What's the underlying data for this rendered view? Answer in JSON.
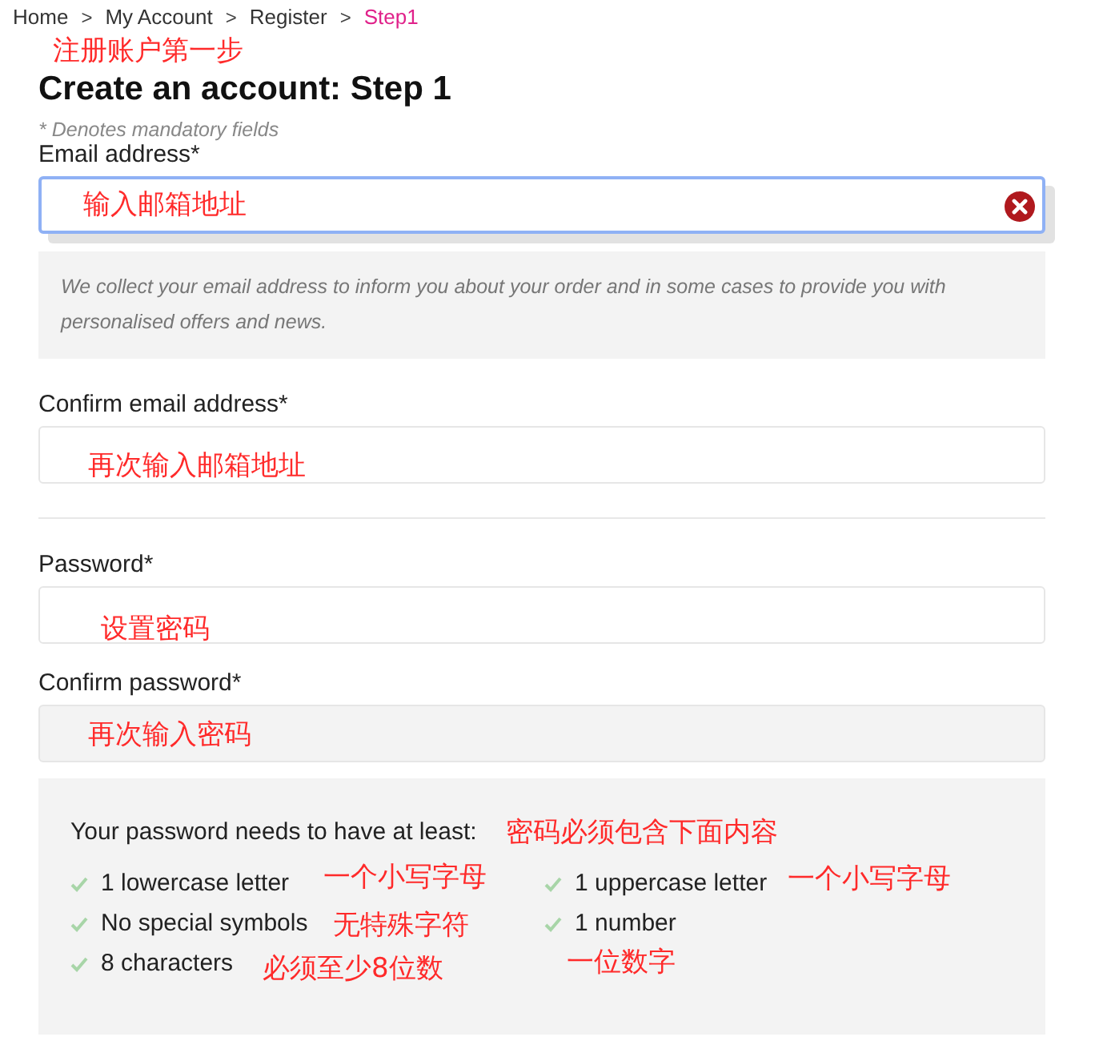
{
  "breadcrumb": [
    {
      "label": "Home",
      "selected": false
    },
    {
      "label": "My Account",
      "selected": false
    },
    {
      "label": "Register",
      "selected": false
    },
    {
      "label": "Step1",
      "selected": true
    }
  ],
  "breadcrumb_separator": ">",
  "title": "Create an account: Step 1",
  "title_annotation": "注册账户第一步",
  "mandatory_note": "* Denotes mandatory fields",
  "fields": [
    {
      "kind": "field",
      "label": "Email address*",
      "annotation": "输入邮箱地址",
      "focused": true,
      "error": true,
      "disabled": false,
      "help": "We collect your email address to inform you about your order and in some cases to provide you with personalised offers and news."
    },
    {
      "kind": "field",
      "label": "Confirm email address*",
      "annotation": "再次输入邮箱地址",
      "focused": false,
      "error": false,
      "disabled": false
    },
    {
      "kind": "divider"
    },
    {
      "kind": "field",
      "label": "Password*",
      "annotation": "设置密码",
      "focused": false,
      "error": false,
      "disabled": false
    },
    {
      "kind": "field",
      "label": "Confirm password*",
      "annotation": "再次输入密码",
      "focused": false,
      "error": false,
      "disabled": true
    }
  ],
  "requirements": {
    "heading": "Your password needs to have at least:",
    "heading_annotation": "密码必须包含下面内容",
    "columns": [
      [
        {
          "label": "1 lowercase letter",
          "met": true,
          "annotation": "一个小写字母"
        },
        {
          "label": "No special symbols",
          "met": true,
          "annotation": "无特殊字符"
        },
        {
          "label": "8 characters",
          "met": true,
          "annotation": "必须至少8位数"
        }
      ],
      [
        {
          "label": "1 uppercase letter",
          "met": true,
          "annotation": "一个小写字母"
        },
        {
          "label": "1 number",
          "met": true,
          "annotation": "一位数字"
        }
      ]
    ]
  }
}
